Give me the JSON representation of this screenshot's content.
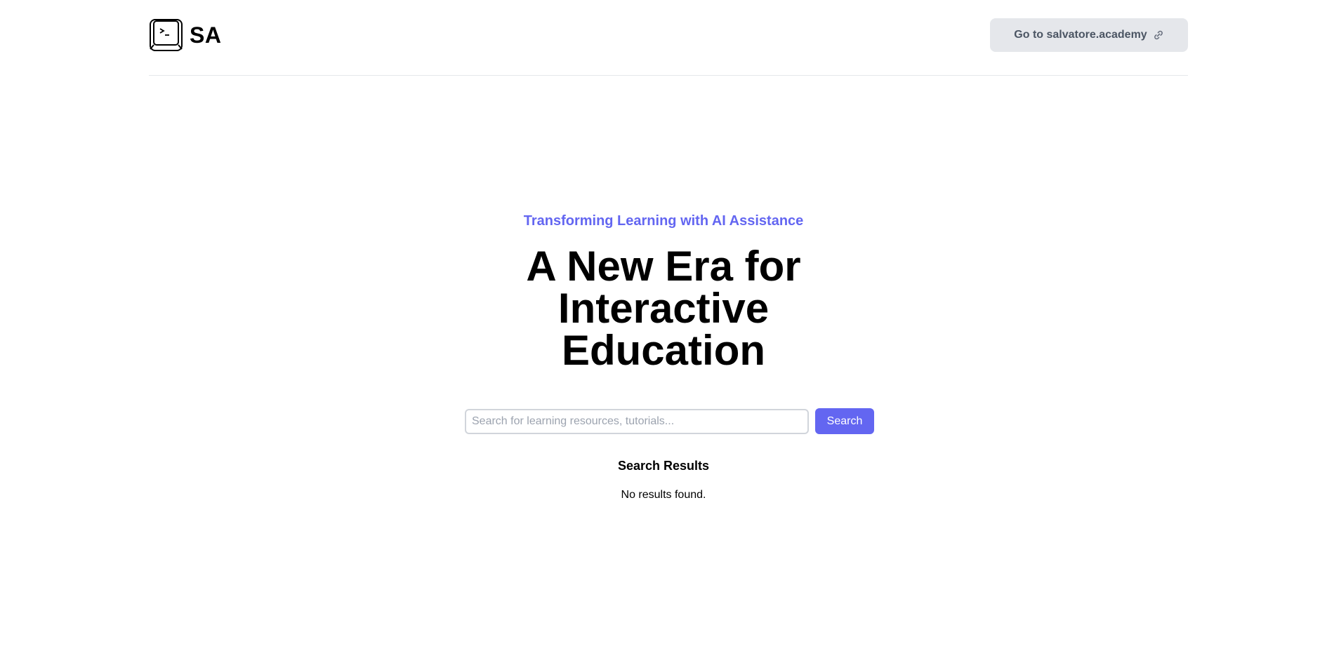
{
  "header": {
    "brand_name": "SA",
    "logo_icon": "terminal-key-icon",
    "site_link_label": "Go to salvatore.academy",
    "site_link_icon": "link-icon"
  },
  "hero": {
    "tagline": "Transforming Learning with AI Assistance",
    "title": "A New Era for Interactive Education"
  },
  "search": {
    "placeholder": "Search for learning resources, tutorials...",
    "value": "",
    "button_label": "Search"
  },
  "results": {
    "heading": "Search Results",
    "empty_message": "No results found."
  },
  "colors": {
    "accent": "#6366f1",
    "link_button_bg": "#e5e7eb",
    "link_button_text": "#4b5563",
    "divider": "#e5e7eb"
  }
}
